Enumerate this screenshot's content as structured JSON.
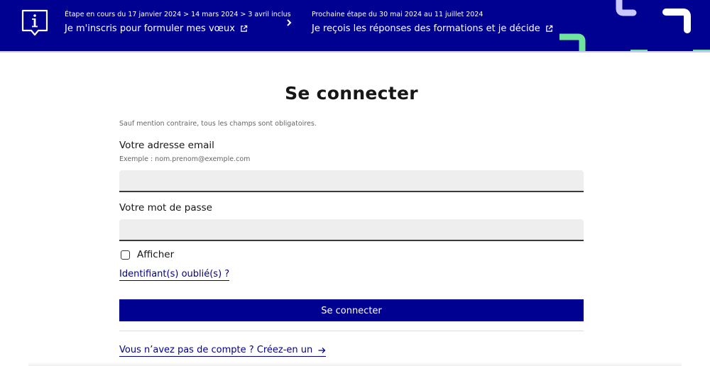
{
  "banner": {
    "current_step_caption": "Étape en cours du 17 janvier 2024 > 14 mars 2024 > 3 avril inclus",
    "current_step_link": "Je m'inscris pour formuler mes vœux",
    "next_step_caption": "Prochaine étape du 30 mai 2024 au 11 juillet 2024",
    "next_step_link": "Je reçois les réponses des formations et je décide",
    "icons": {
      "info": "info-speech-icon",
      "external": "external-link-icon",
      "chevron": "chevron-right-icon"
    }
  },
  "form": {
    "title": "Se connecter",
    "notice": "Sauf mention contraire, tous les champs sont obligatoires.",
    "email_label": "Votre adresse email",
    "email_hint": "Exemple : nom.prenom@exemple.com",
    "email_value": "",
    "password_label": "Votre mot de passe",
    "password_value": "",
    "show_password_label": "Afficher",
    "forgot_link": "Identifiant(s) oublié(s) ?",
    "submit_label": "Se connecter",
    "create_account_link": "Vous n’avez pas de compte ? Créez-en un"
  },
  "colors": {
    "brand_blue": "#000091",
    "input_bg": "#eeeeee",
    "deco_light_blue": "#c8c8ff",
    "deco_green": "#6fe49d"
  }
}
